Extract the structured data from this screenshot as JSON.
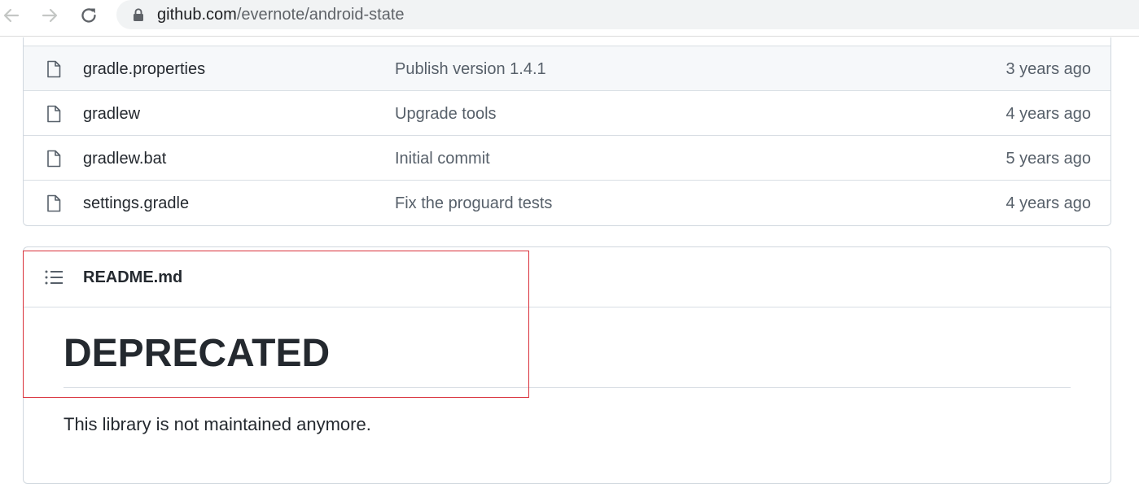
{
  "browser": {
    "url_host": "github.com",
    "url_path": "/evernote/android-state",
    "icons": {
      "back": "arrow-left-icon",
      "forward": "arrow-right-icon",
      "reload": "reload-icon",
      "lock": "lock-icon"
    }
  },
  "files": [
    {
      "name": "gradle.properties",
      "message": "Publish version 1.4.1",
      "age": "3 years ago",
      "icon": "file-icon"
    },
    {
      "name": "gradlew",
      "message": "Upgrade tools",
      "age": "4 years ago",
      "icon": "file-icon"
    },
    {
      "name": "gradlew.bat",
      "message": "Initial commit",
      "age": "5 years ago",
      "icon": "file-icon"
    },
    {
      "name": "settings.gradle",
      "message": "Fix the proguard tests",
      "age": "4 years ago",
      "icon": "file-icon"
    }
  ],
  "readme": {
    "filename": "README.md",
    "heading": "DEPRECATED",
    "paragraph": "This library is not maintained anymore.",
    "toc_icon": "list-icon"
  },
  "colors": {
    "highlight": "#d9303a",
    "row_hover": "#f6f8fa",
    "border": "#d0d7de"
  }
}
